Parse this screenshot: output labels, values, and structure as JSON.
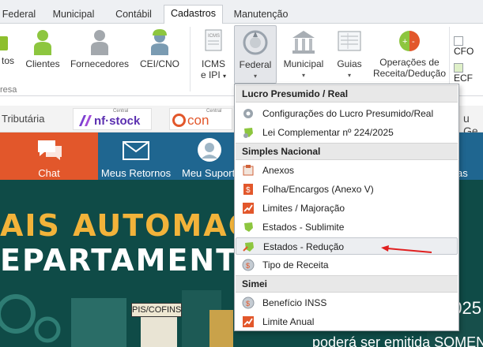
{
  "tabs": [
    {
      "label": "Federal"
    },
    {
      "label": "Municipal"
    },
    {
      "label": "Contábil"
    },
    {
      "label": "Cadastros"
    },
    {
      "label": "Manutenção"
    }
  ],
  "ribbon": {
    "group_label": "resa",
    "buttons": [
      {
        "label": "tos"
      },
      {
        "label": "Clientes"
      },
      {
        "label": "Fornecedores"
      },
      {
        "label": "CEI/CNO"
      },
      {
        "label_1": "ICMS",
        "label_2": "e IPI"
      },
      {
        "label": "Federal"
      },
      {
        "label": "Municipal"
      },
      {
        "label": "Guias"
      },
      {
        "label_1": "Operações de",
        "label_2": "Receita/Dedução"
      }
    ],
    "side": [
      {
        "label": "CFO"
      },
      {
        "label": "ECF"
      }
    ],
    "caret": "▾"
  },
  "partners": {
    "left_text": "Tributária",
    "nfstock_top": "Central",
    "nfstock": "nf·stock",
    "conn_top": "Central",
    "conn": "con",
    "right_text": "u Ge"
  },
  "quicknav": {
    "items": [
      {
        "label": "Chat"
      },
      {
        "label": "Meus Retornos"
      },
      {
        "label": "Meu Suport"
      },
      {
        "label": "as"
      }
    ]
  },
  "banner": {
    "line1": "AIS AUTOMAÇ",
    "line2": "EPARTAMENT",
    "tag": "PIS/COFINS",
    "footer": "poderá ser emitida SOMEN",
    "right_num": "2025"
  },
  "menu": {
    "sections": [
      {
        "title": "Lucro Presumido / Real",
        "items": [
          "Configurações do Lucro Presumido/Real",
          "Lei Complementar nº 224/2025"
        ]
      },
      {
        "title": "Simples Nacional",
        "items": [
          "Anexos",
          "Folha/Encargos (Anexo V)",
          "Limites / Majoração",
          "Estados - Sublimite",
          "Estados - Redução",
          "Tipo de Receita"
        ]
      },
      {
        "title": "Simei",
        "items": [
          "Benefício INSS",
          "Limite Anual"
        ]
      }
    ]
  },
  "colors": {
    "accent_orange": "#e2572b",
    "nav_blue": "#1f6690",
    "banner_green": "#0f4b47",
    "arrow_red": "#e02020"
  }
}
